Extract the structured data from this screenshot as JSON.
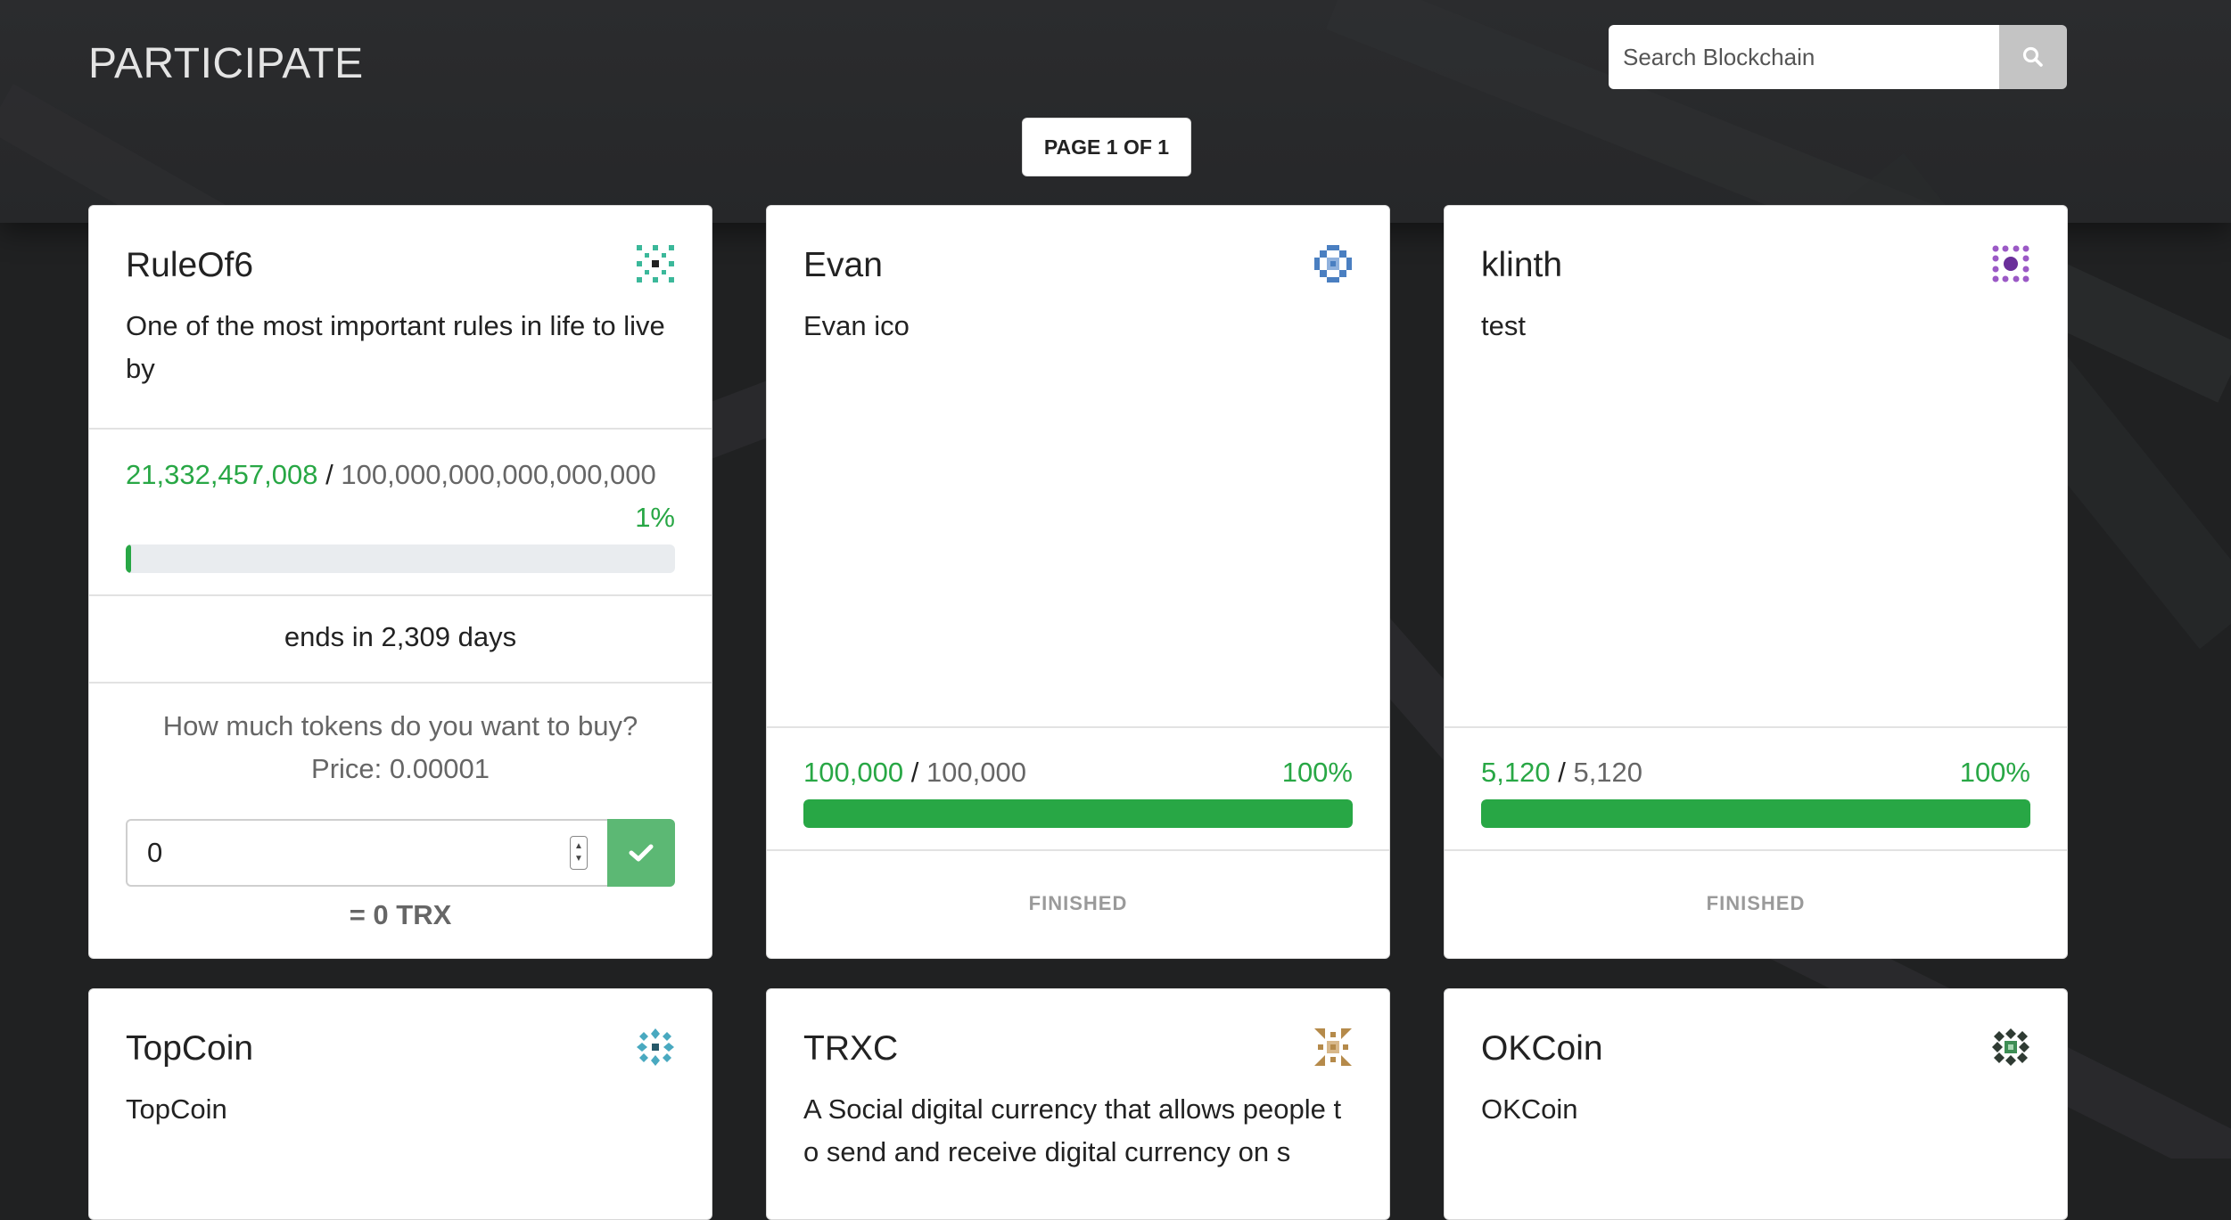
{
  "header": {
    "title": "PARTICIPATE",
    "search_placeholder": "Search Blockchain",
    "page_indicator": "PAGE 1 OF 1"
  },
  "cards": [
    {
      "name": "RuleOf6",
      "description": "One of the most important rules in life to live by",
      "raised": "21,332,457,008",
      "separator": "/",
      "goal": "100,000,000,000,000,000",
      "percent": "1%",
      "progress_fraction": 0.01,
      "ends": "ends in 2,309 days",
      "buy_question": "How much tokens do you want to buy?",
      "price": "Price: 0.00001",
      "amount_value": "0",
      "total": "= 0 TRX",
      "icon": "identicon-teal",
      "icon_color": "#3bb89a"
    },
    {
      "name": "Evan",
      "description": "Evan ico",
      "raised": "100,000",
      "separator": "/",
      "goal": "100,000",
      "percent": "100%",
      "progress_fraction": 1.0,
      "status": "FINISHED",
      "icon": "identicon-blue",
      "icon_color": "#4a7fc1"
    },
    {
      "name": "klinth",
      "description": "test",
      "raised": "5,120",
      "separator": "/",
      "goal": "5,120",
      "percent": "100%",
      "progress_fraction": 1.0,
      "status": "FINISHED",
      "icon": "identicon-purple",
      "icon_color": "#9b59c6"
    },
    {
      "name": "TopCoin",
      "description": "TopCoin",
      "icon": "identicon-cyan",
      "icon_color": "#49a9c0"
    },
    {
      "name": "TRXC",
      "description": "A Social digital currency that allows people to send and receive digital currency on s",
      "icon": "identicon-gold",
      "icon_color": "#b58a4a"
    },
    {
      "name": "OKCoin",
      "description": "OKCoin",
      "icon": "identicon-green",
      "icon_color": "#3e8e55"
    }
  ],
  "colors": {
    "accent_green": "#28a745",
    "confirm_button": "#5cb874",
    "background": "#202122"
  }
}
